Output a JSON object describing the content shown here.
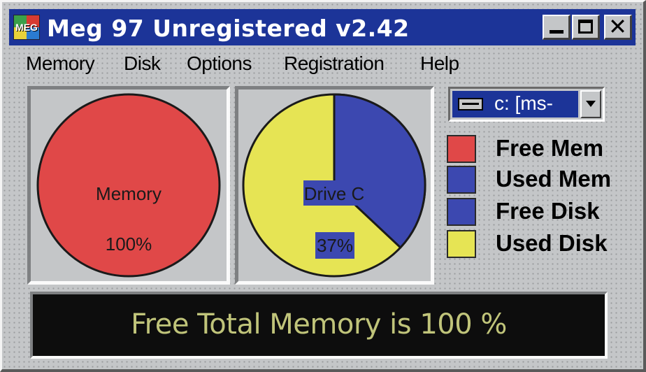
{
  "window": {
    "title": "Meg 97 Unregistered v2.42",
    "icon_text": "MEG",
    "icon": "meg-app-icon"
  },
  "caption_buttons": {
    "minimize": "minimize-icon",
    "maximize": "maximize-icon",
    "close": "✕"
  },
  "menu": {
    "items": [
      {
        "label": "Memory"
      },
      {
        "label": "Disk"
      },
      {
        "label": "Options"
      },
      {
        "label": "Registration"
      },
      {
        "label": "Help"
      }
    ]
  },
  "memory_panel": {
    "label": "Memory",
    "percent_text": "100%",
    "free_fraction": 1.0
  },
  "disk_panel": {
    "label": "Drive C",
    "percent_text": "37%",
    "free_fraction": 0.37
  },
  "drive_selector": {
    "value": "c: [ms-",
    "icon": "drive-icon"
  },
  "legend": {
    "items": [
      {
        "label": "Free Mem",
        "color": "#e04848"
      },
      {
        "label": "Used Mem",
        "color": "#3c48b0"
      },
      {
        "label": "Free Disk",
        "color": "#3c48b0"
      },
      {
        "label": "Used Disk",
        "color": "#e6e454"
      }
    ]
  },
  "status": {
    "text": "Free Total Memory is 100 %"
  },
  "colors": {
    "title_bar": "#1c3498",
    "free_mem": "#e04848",
    "used_mem": "#3c48b0",
    "free_disk": "#3c48b0",
    "used_disk": "#e6e454",
    "status_text": "#c0c47a",
    "status_bg": "#0d0d0d"
  }
}
